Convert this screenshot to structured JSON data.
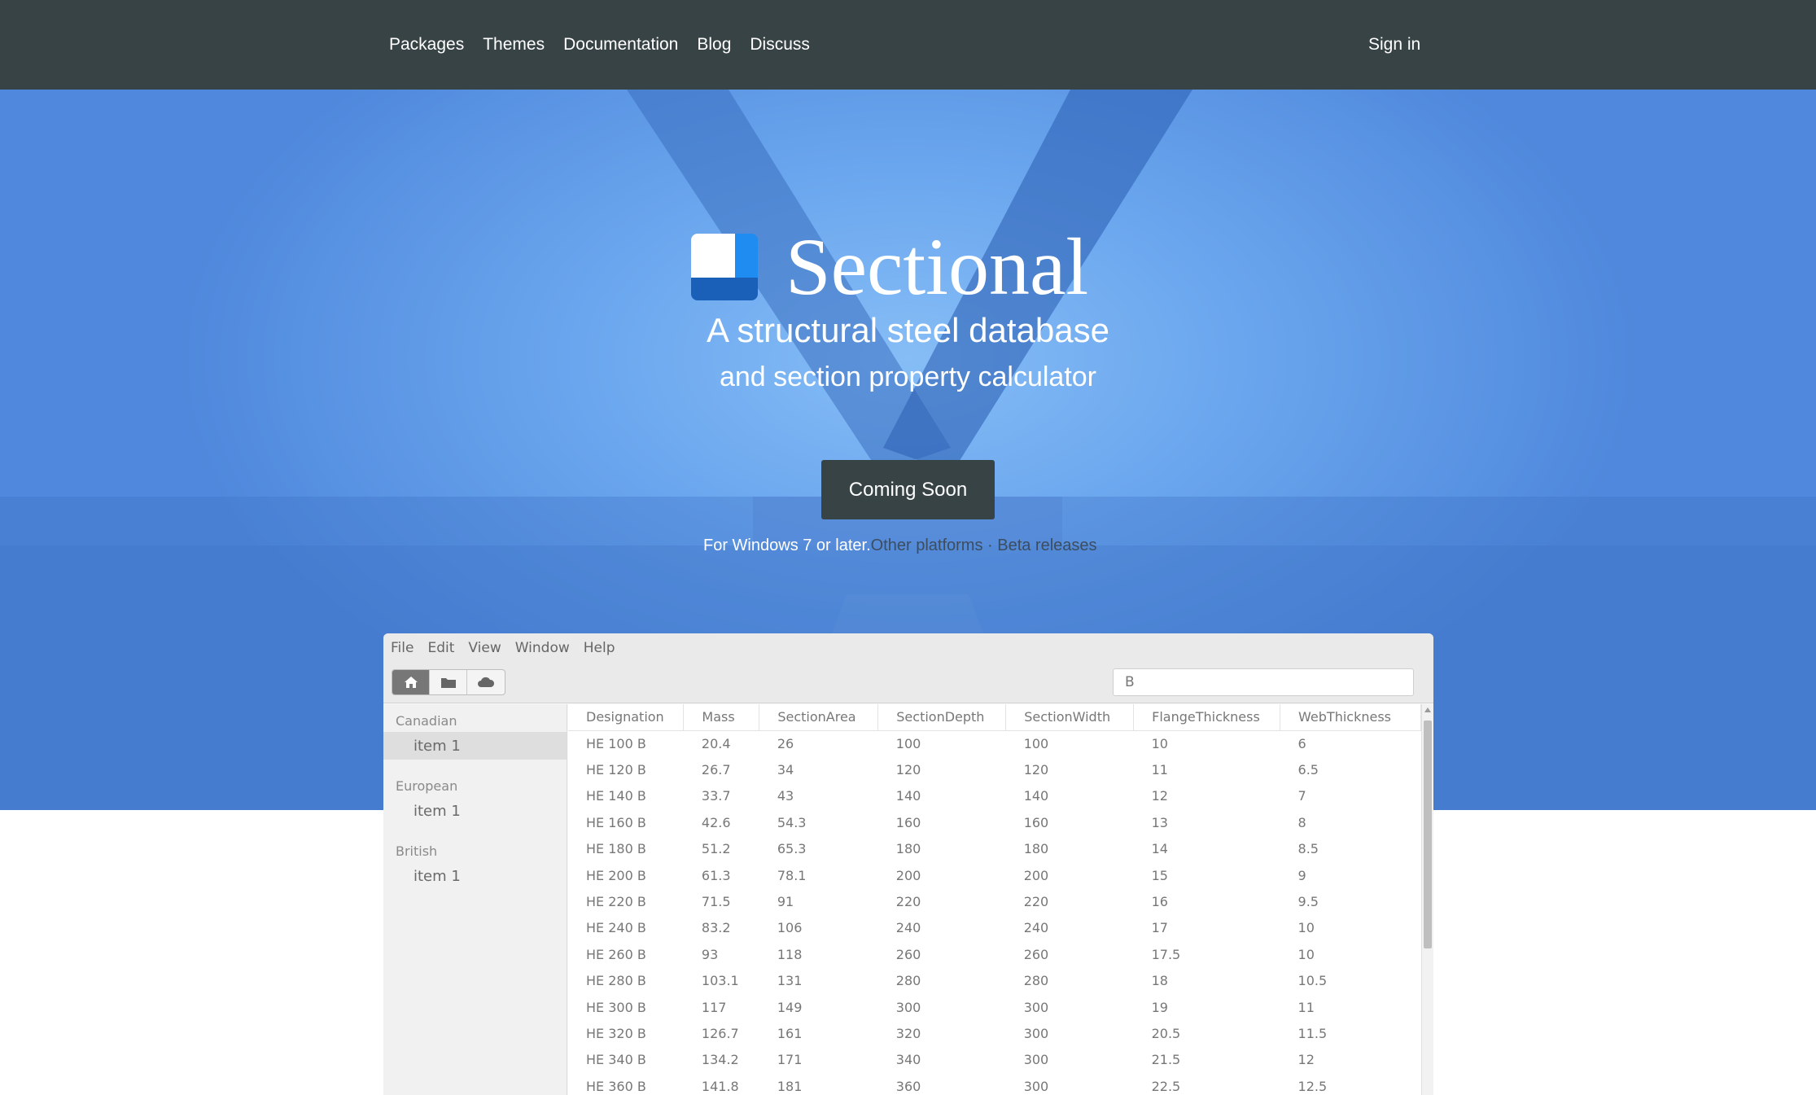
{
  "nav": {
    "links": [
      "Packages",
      "Themes",
      "Documentation",
      "Blog",
      "Discuss"
    ],
    "sign_in": "Sign in"
  },
  "hero": {
    "title": "Sectional",
    "tagline_line1": "A structural steel database",
    "tagline_line2": "and section property calculator",
    "cta": "Coming Soon",
    "platform_note": "For Windows 7 or later.",
    "other_platforms": "Other platforms",
    "separator": " · ",
    "beta_releases": "Beta releases",
    "colors": {
      "accent_dark": "#374345",
      "hero_blue": "#6aa6ee"
    }
  },
  "app": {
    "menu": [
      "File",
      "Edit",
      "View",
      "Window",
      "Help"
    ],
    "toolbar_icons": [
      "home-icon",
      "folder-icon",
      "cloud-icon"
    ],
    "search_value": "B",
    "sidebar": [
      {
        "group": "Canadian",
        "items": [
          "item 1"
        ]
      },
      {
        "group": "European",
        "items": [
          "item 1"
        ]
      },
      {
        "group": "British",
        "items": [
          "item 1"
        ]
      }
    ],
    "table": {
      "columns": [
        "Designation",
        "Mass",
        "SectionArea",
        "SectionDepth",
        "SectionWidth",
        "FlangeThickness",
        "WebThickness"
      ],
      "rows": [
        [
          "HE 100 B",
          "20.4",
          "26",
          "100",
          "100",
          "10",
          "6"
        ],
        [
          "HE 120 B",
          "26.7",
          "34",
          "120",
          "120",
          "11",
          "6.5"
        ],
        [
          "HE 140 B",
          "33.7",
          "43",
          "140",
          "140",
          "12",
          "7"
        ],
        [
          "HE 160 B",
          "42.6",
          "54.3",
          "160",
          "160",
          "13",
          "8"
        ],
        [
          "HE 180 B",
          "51.2",
          "65.3",
          "180",
          "180",
          "14",
          "8.5"
        ],
        [
          "HE 200 B",
          "61.3",
          "78.1",
          "200",
          "200",
          "15",
          "9"
        ],
        [
          "HE 220 B",
          "71.5",
          "91",
          "220",
          "220",
          "16",
          "9.5"
        ],
        [
          "HE 240 B",
          "83.2",
          "106",
          "240",
          "240",
          "17",
          "10"
        ],
        [
          "HE 260 B",
          "93",
          "118",
          "260",
          "260",
          "17.5",
          "10"
        ],
        [
          "HE 280 B",
          "103.1",
          "131",
          "280",
          "280",
          "18",
          "10.5"
        ],
        [
          "HE 300 B",
          "117",
          "149",
          "300",
          "300",
          "19",
          "11"
        ],
        [
          "HE 320 B",
          "126.7",
          "161",
          "320",
          "300",
          "20.5",
          "11.5"
        ],
        [
          "HE 340 B",
          "134.2",
          "171",
          "340",
          "300",
          "21.5",
          "12"
        ],
        [
          "HE 360 B",
          "141.8",
          "181",
          "360",
          "300",
          "22.5",
          "12.5"
        ]
      ]
    }
  }
}
